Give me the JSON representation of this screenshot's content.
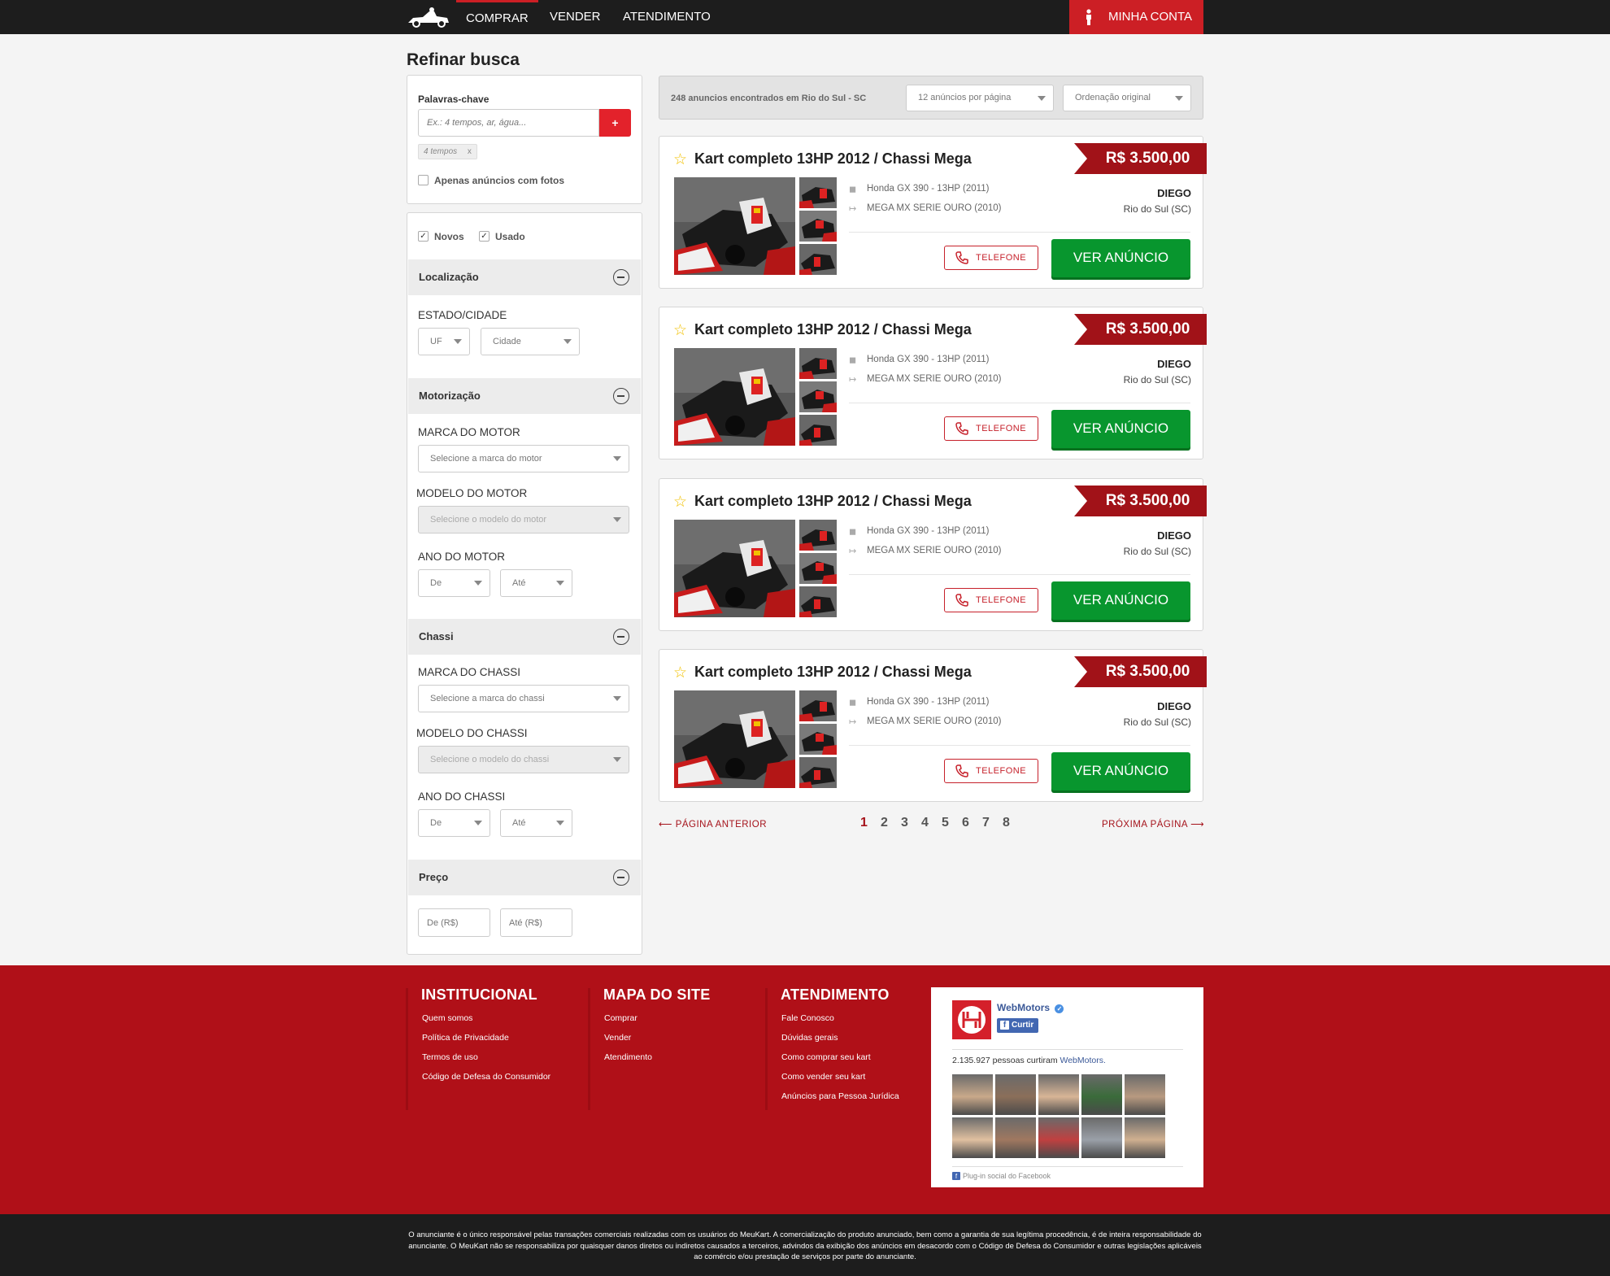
{
  "header": {
    "nav": [
      "COMPRAR",
      "VENDER",
      "ATENDIMENTO"
    ],
    "account": "MINHA CONTA"
  },
  "sidebar": {
    "title": "Refinar busca",
    "keywords_label": "Palavras-chave",
    "keywords_placeholder": "Ex.: 4 tempos, ar, água...",
    "add_label": "+",
    "tag": "4 tempos",
    "tag_remove": "x",
    "only_photos": "Apenas anúncios com fotos",
    "new_label": "Novos",
    "used_label": "Usado",
    "location": {
      "title": "Localização",
      "state_city_label": "ESTADO/CIDADE",
      "uf": "UF",
      "city": "Cidade"
    },
    "engine": {
      "title": "Motorização",
      "brand_label": "MARCA DO MOTOR",
      "brand_placeholder": "Selecione a marca do motor",
      "model_label": "MODELO DO MOTOR",
      "model_placeholder": "Selecione o modelo do motor",
      "year_label": "ANO DO MOTOR",
      "from": "De",
      "to": "Até"
    },
    "chassis": {
      "title": "Chassi",
      "brand_label": "MARCA DO CHASSI",
      "brand_placeholder": "Selecione a marca do chassi",
      "model_label": "MODELO DO CHASSI",
      "model_placeholder": "Selecione o modelo do chassi",
      "year_label": "ANO DO CHASSI",
      "from": "De",
      "to": "Até"
    },
    "price": {
      "title": "Preço",
      "from": "De (R$)",
      "to": "Até (R$)"
    }
  },
  "results": {
    "count_text": "248 anuncios encontrados em Rio do Sul - SC",
    "per_page": "12 anúncios por página",
    "order": "Ordenação original",
    "listings": [
      {
        "title": "Kart completo 13HP 2012 / Chassi Mega",
        "price": "R$ 3.500,00",
        "engine": "Honda GX 390 - 13HP (2011)",
        "chassis": "MEGA MX SERIE OURO (2010)",
        "seller": "DIEGO",
        "city": "Rio do Sul (SC)",
        "phone_label": "TELEFONE",
        "view_label": "VER ANÚNCIO"
      },
      {
        "title": "Kart completo 13HP 2012 / Chassi Mega",
        "price": "R$ 3.500,00",
        "engine": "Honda GX 390 - 13HP (2011)",
        "chassis": "MEGA MX SERIE OURO (2010)",
        "seller": "DIEGO",
        "city": "Rio do Sul (SC)",
        "phone_label": "TELEFONE",
        "view_label": "VER ANÚNCIO"
      },
      {
        "title": "Kart completo 13HP 2012 / Chassi Mega",
        "price": "R$ 3.500,00",
        "engine": "Honda GX 390 - 13HP (2011)",
        "chassis": "MEGA MX SERIE OURO (2010)",
        "seller": "DIEGO",
        "city": "Rio do Sul (SC)",
        "phone_label": "TELEFONE",
        "view_label": "VER ANÚNCIO"
      },
      {
        "title": "Kart completo 13HP 2012 / Chassi Mega",
        "price": "R$ 3.500,00",
        "engine": "Honda GX 390 - 13HP (2011)",
        "chassis": "MEGA MX SERIE OURO (2010)",
        "seller": "DIEGO",
        "city": "Rio do Sul (SC)",
        "phone_label": "TELEFONE",
        "view_label": "VER ANÚNCIO"
      }
    ],
    "pagination": {
      "prev": "PÁGINA ANTERIOR",
      "next": "PRÓXIMA PÁGINA",
      "pages": [
        "1",
        "2",
        "3",
        "4",
        "5",
        "6",
        "7",
        "8"
      ],
      "current": "1"
    }
  },
  "footer": {
    "institucional": {
      "title": "INSTITUCIONAL",
      "links": [
        "Quem somos",
        "Política de Privacidade",
        "Termos de uso",
        "Código de Defesa do Consumidor"
      ]
    },
    "mapa": {
      "title": "MAPA DO SITE",
      "links": [
        "Comprar",
        "Vender",
        "Atendimento"
      ]
    },
    "atendimento": {
      "title": "ATENDIMENTO",
      "links": [
        "Fale Conosco",
        "Dúvidas gerais",
        "Como comprar seu kart",
        "Como vender seu kart",
        "Anúncios para Pessoa Jurídica"
      ]
    },
    "facebook": {
      "page_name": "WebMotors",
      "like_label": "Curtir",
      "likes_text": "2.135.927 pessoas curtiram",
      "likes_link": "WebMotors.",
      "plugin_label": "Plug-in social do Facebook"
    },
    "disclaimer": "O anunciante é o único responsável pelas transações comerciais realizadas com os usuários do MeuKart. A comercialização do produto anunciado, bem como a garantia de sua legítima procedência, é de inteira responsabilidade do anunciante. O MeuKart não se responsabiliza por quaisquer danos diretos ou indiretos causados a terceiros, advindos da exibição dos anúncios em desacordo com o Código de Defesa do Consumidor e outras legislações aplicáveis ao comércio e/ou prestação de serviços por parte do anunciante."
  },
  "colors": {
    "brand_red": "#cc1f25",
    "footer_red": "#b01018",
    "price_ribbon": "#a11218",
    "green_button": "#08962e"
  }
}
